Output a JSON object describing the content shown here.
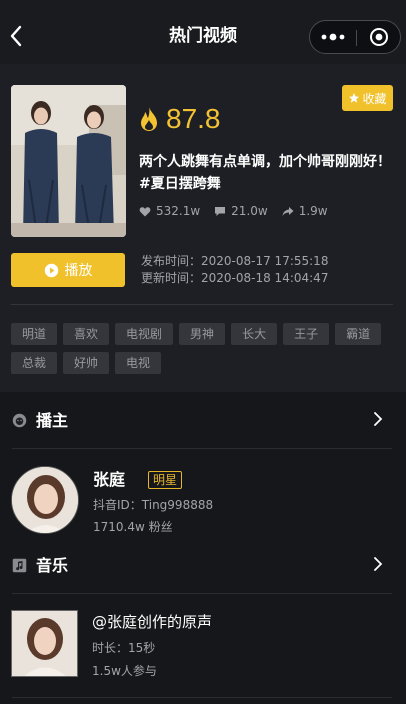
{
  "nav": {
    "title": "热门视频",
    "back_icon": "chevron-left-icon",
    "more_icon": "more-dots-icon",
    "close_icon": "target-close-icon"
  },
  "video": {
    "favorite_label": "收藏",
    "score": "87.8",
    "title": "两个人跳舞有点单调，加个帅哥刚刚好！ #夏日摆跨舞",
    "likes": "532.1w",
    "comments": "21.0w",
    "shares": "1.9w",
    "play_label": "播放",
    "publish_time": "发布时间：2020-08-17 17:55:18",
    "update_time": "更新时间：2020-08-18 14:04:47",
    "tags": [
      "明道",
      "喜欢",
      "电视剧",
      "男神",
      "长大",
      "王子",
      "霸道",
      "总裁",
      "好帅",
      "电视"
    ]
  },
  "host_section": {
    "title": "播主",
    "name": "张庭",
    "badge": "明星",
    "douyin_id": "抖音ID：Ting998888",
    "fans": "1710.4w 粉丝"
  },
  "music_section": {
    "title": "音乐",
    "name": "@张庭创作的原声",
    "duration": "时长：15秒",
    "participants": "1.5w人参与"
  },
  "colors": {
    "accent": "#f0c12b",
    "score": "#f3c233",
    "background": "#16171b",
    "card": "#1e1f24",
    "tag_bg": "#35363c"
  }
}
